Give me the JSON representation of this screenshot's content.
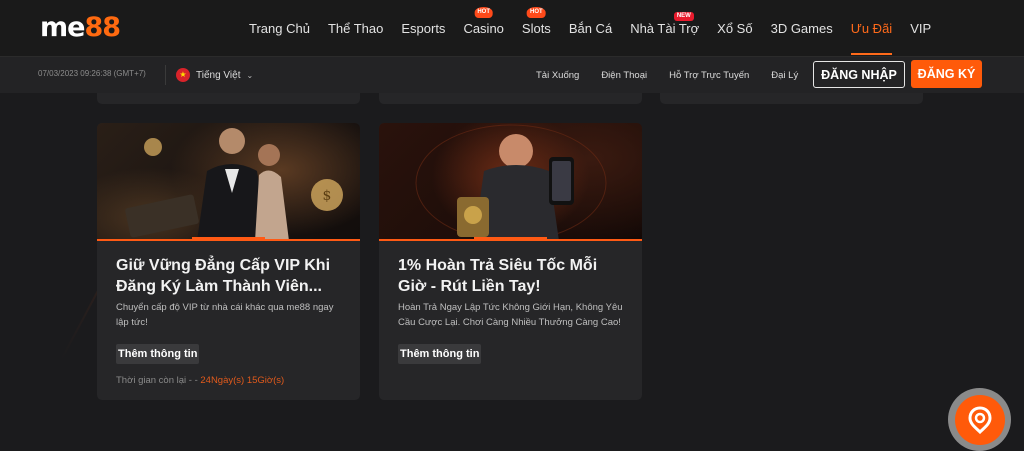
{
  "header": {
    "logo": {
      "me": "me",
      "num": "88"
    },
    "nav": [
      {
        "label": "Trang Chủ"
      },
      {
        "label": "Thể Thao"
      },
      {
        "label": "Esports"
      },
      {
        "label": "Casino",
        "badge": "HOT"
      },
      {
        "label": "Slots",
        "badge": "HOT"
      },
      {
        "label": "Bắn Cá"
      },
      {
        "label": "Nhà Tài Trợ",
        "badge": "NEW"
      },
      {
        "label": "Xổ Số"
      },
      {
        "label": "3D Games"
      },
      {
        "label": "Ưu Đãi",
        "active": true
      },
      {
        "label": "VIP"
      }
    ]
  },
  "subbar": {
    "datetime": "07/03/2023 09:26:38 (GMT+7)",
    "language": "Tiếng Việt",
    "links": [
      "Tải Xuống",
      "Điện Thoại",
      "Hỗ Trợ Trực Tuyến",
      "Đại Lý"
    ],
    "login_label": "ĐĂNG NHẬP",
    "register_label": "ĐĂNG KÝ"
  },
  "promos": [
    {
      "title": "Giữ Vững Đẳng Cấp VIP Khi Đăng Ký Làm Thành Viên...",
      "description": "Chuyển cấp độ VIP từ nhà cái khác qua me88 ngay lập tức!",
      "more_label": "Thêm thông tin",
      "time_left_label": "Thời gian còn lại - -",
      "time_left_value": "24Ngày(s) 15Giờ(s)"
    },
    {
      "title": "1% Hoàn Trả Siêu Tốc Mỗi Giờ - Rút Liền Tay!",
      "description": "Hoàn Trả Ngay Lập Tức Không Giới Hạn, Không Yêu Cầu Cược Lại. Chơi Càng Nhiều Thưởng Càng Cao!",
      "more_label": "Thêm thông tin"
    }
  ],
  "colors": {
    "accent": "#ff5a0a",
    "background": "#1b1b1d",
    "card": "#262628"
  },
  "icons": {
    "help": "chat-support-icon",
    "language": "vietnam-flag-icon",
    "dropdown": "chevron-down-icon"
  }
}
